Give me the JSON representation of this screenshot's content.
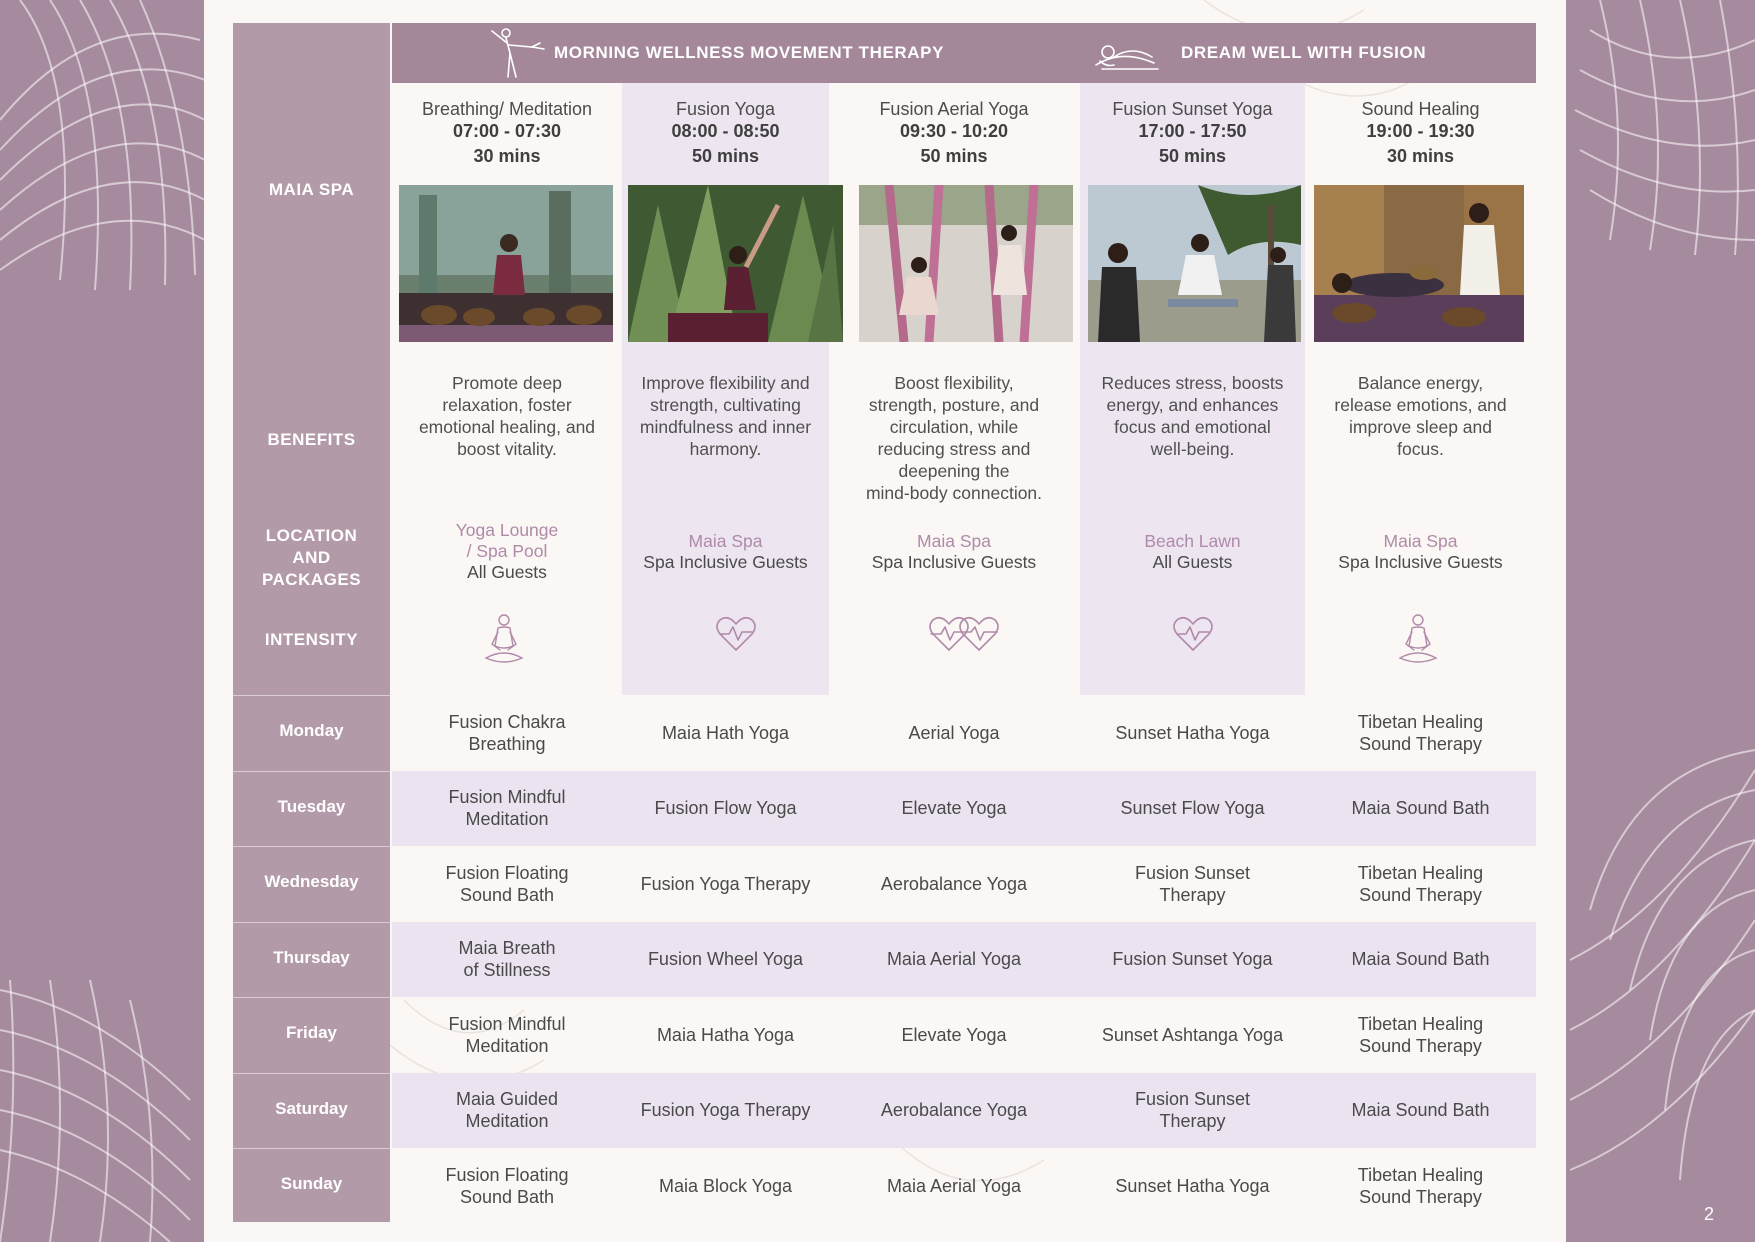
{
  "header": {
    "morning": "MORNING WELLNESS MOVEMENT THERAPY",
    "evening": "DREAM WELL WITH FUSION",
    "morning_icon": "yoga-pose-icon",
    "evening_icon": "reclining-person-icon"
  },
  "row_labels": {
    "maia_spa": "MAIA SPA",
    "benefits": "BENEFITS",
    "location": [
      "LOCATION",
      "AND",
      "PACKAGES"
    ],
    "intensity": "INTENSITY"
  },
  "classes": [
    {
      "title": "Breathing/ Meditation",
      "time": "07:00 - 07:30",
      "duration": "30 mins",
      "benefit": [
        "Promote deep",
        "relaxation, foster",
        "emotional healing, and",
        "boost vitality."
      ],
      "location": [
        "Yoga Lounge",
        "/ Spa Pool"
      ],
      "package": "All Guests",
      "intensity_icon": "meditation-figure-icon"
    },
    {
      "title": "Fusion Yoga",
      "time": "08:00 - 08:50",
      "duration": "50 mins",
      "benefit": [
        "Improve flexibility and",
        "strength, cultivating",
        "mindfulness and inner",
        "harmony."
      ],
      "location": [
        "Maia Spa"
      ],
      "package": "Spa Inclusive Guests",
      "intensity_icon": "heartbeat-icon"
    },
    {
      "title": "Fusion Aerial Yoga",
      "time": "09:30 - 10:20",
      "duration": "50 mins",
      "benefit": [
        "Boost flexibility,",
        "strength, posture, and",
        "circulation, while",
        "reducing stress and",
        "deepening the",
        "mind-body connection."
      ],
      "location": [
        "Maia Spa"
      ],
      "package": "Spa Inclusive Guests",
      "intensity_icon": "double-heartbeat-icon"
    },
    {
      "title": "Fusion Sunset Yoga",
      "time": "17:00 - 17:50",
      "duration": "50 mins",
      "benefit": [
        "Reduces stress, boosts",
        "energy, and enhances",
        "focus and emotional",
        "well-being."
      ],
      "location": [
        "Beach Lawn"
      ],
      "package": "All Guests",
      "intensity_icon": "heartbeat-icon"
    },
    {
      "title": "Sound Healing",
      "time": "19:00 - 19:30",
      "duration": "30 mins",
      "benefit": [
        "Balance energy,",
        "release emotions, and",
        "improve sleep and",
        "focus."
      ],
      "location": [
        "Maia Spa"
      ],
      "package": "Spa Inclusive Guests",
      "intensity_icon": "meditation-figure-icon"
    }
  ],
  "schedule": [
    {
      "day": "Monday",
      "cells": [
        [
          "Fusion Chakra",
          "Breathing"
        ],
        [
          "Maia Hath Yoga"
        ],
        [
          "Aerial Yoga"
        ],
        [
          "Sunset Hatha Yoga"
        ],
        [
          "Tibetan Healing",
          "Sound Therapy"
        ]
      ]
    },
    {
      "day": "Tuesday",
      "cells": [
        [
          "Fusion Mindful",
          "Meditation"
        ],
        [
          "Fusion Flow Yoga"
        ],
        [
          "Elevate Yoga"
        ],
        [
          "Sunset Flow Yoga"
        ],
        [
          "Maia Sound Bath"
        ]
      ]
    },
    {
      "day": "Wednesday",
      "cells": [
        [
          "Fusion Floating",
          "Sound Bath"
        ],
        [
          "Fusion Yoga Therapy"
        ],
        [
          "Aerobalance Yoga"
        ],
        [
          "Fusion Sunset",
          "Therapy"
        ],
        [
          "Tibetan Healing",
          "Sound Therapy"
        ]
      ]
    },
    {
      "day": "Thursday",
      "cells": [
        [
          "Maia Breath",
          "of Stillness"
        ],
        [
          "Fusion Wheel Yoga"
        ],
        [
          "Maia Aerial Yoga"
        ],
        [
          "Fusion Sunset Yoga"
        ],
        [
          "Maia Sound Bath"
        ]
      ]
    },
    {
      "day": "Friday",
      "cells": [
        [
          "Fusion Mindful",
          "Meditation"
        ],
        [
          "Maia Hatha Yoga"
        ],
        [
          "Elevate Yoga"
        ],
        [
          "Sunset Ashtanga Yoga"
        ],
        [
          "Tibetan Healing",
          "Sound Therapy"
        ]
      ]
    },
    {
      "day": "Saturday",
      "cells": [
        [
          "Maia Guided",
          "Meditation"
        ],
        [
          "Fusion Yoga Therapy"
        ],
        [
          "Aerobalance Yoga"
        ],
        [
          "Fusion Sunset",
          "Therapy"
        ],
        [
          "Maia Sound Bath"
        ]
      ]
    },
    {
      "day": "Sunday",
      "cells": [
        [
          "Fusion Floating",
          "Sound Bath"
        ],
        [
          "Maia Block Yoga"
        ],
        [
          "Maia Aerial Yoga"
        ],
        [
          "Sunset Hatha Yoga"
        ],
        [
          "Tibetan Healing",
          "Sound Therapy"
        ]
      ]
    }
  ],
  "page_number": "2",
  "colors": {
    "background": "#a68a9d",
    "label_column": "#b39aa9",
    "header_bar": "#a48799",
    "column_tint": "#ede5f0",
    "location_text": "#b08aa9",
    "icon_stroke": "#b08aa9"
  }
}
